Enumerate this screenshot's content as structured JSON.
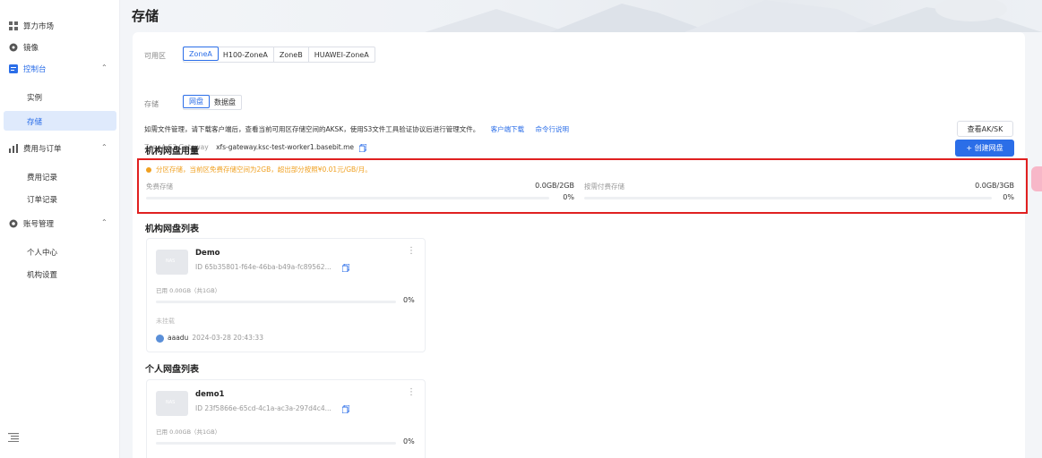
{
  "sidebar": {
    "items": [
      {
        "label": "算力市场",
        "icon": "grid-icon"
      },
      {
        "label": "镜像",
        "icon": "disc-icon"
      },
      {
        "label": "控制台",
        "icon": "console-icon",
        "chevron": "⌃"
      },
      {
        "label": "费用与订单",
        "icon": "chart-icon",
        "chevron": "⌃"
      },
      {
        "label": "账号管理",
        "icon": "gear-icon",
        "chevron": "⌃"
      }
    ],
    "console_sub": [
      "实例",
      "存储"
    ],
    "billing_sub": [
      "费用记录",
      "订单记录"
    ],
    "account_sub": [
      "个人中心",
      "机构设置"
    ]
  },
  "header": {
    "title": "存储"
  },
  "zone": {
    "label": "可用区",
    "options": [
      "ZoneA",
      "H100-ZoneA",
      "ZoneB",
      "HUAWEI-ZoneA"
    ],
    "selected": "ZoneA"
  },
  "storage": {
    "label": "存储",
    "options": [
      "网盘",
      "数据盘"
    ],
    "selected": "网盘"
  },
  "notice": {
    "text": "如需文件管理，请下载客户端后，查看当前可用区存储空间的AKSK，使用S3文件工具验证协议后进行管理文件。",
    "link1": "客户端下载",
    "link2": "命令行说明"
  },
  "gateway": {
    "label": "ZoneA S3 Gateway",
    "value": "xfs-gateway.ksc-test-worker1.basebit.me"
  },
  "aksk_button": "查看AK/SK",
  "org_usage": {
    "title": "机构网盘用量",
    "create_button": "+ 创建网盘",
    "warning": "分区存储，当前区免费存储空间为2GB，超出部分按照¥0.01元/GB/月。",
    "free": {
      "name": "免费存储",
      "amount": "0.0GB/2GB",
      "pct": "0%",
      "fraction": 0
    },
    "paid": {
      "name": "按需付费存储",
      "amount": "0.0GB/3GB",
      "pct": "0%",
      "fraction": 0
    }
  },
  "org_list": {
    "title": "机构网盘列表",
    "disks": [
      {
        "name": "Demo",
        "id": "ID 65b35801-f64e-46ba-b49a-fc89562...",
        "used": "已用 0.00GB（共1GB）",
        "pct": "0%",
        "mount": "未挂载",
        "owner": "aaadu",
        "time": "2024-03-28 20:43:33",
        "thumb": "NAS"
      }
    ]
  },
  "personal_list": {
    "title": "个人网盘列表",
    "disks": [
      {
        "name": "demo1",
        "id": "ID 23f5866e-65cd-4c1a-ac3a-297d4c4...",
        "used": "已用 0.00GB（共1GB）",
        "pct": "0%",
        "thumb": "NAS"
      }
    ]
  },
  "colors": {
    "accent": "#2b6ee8",
    "warning": "#f0a020",
    "highlight": "#e02020"
  }
}
